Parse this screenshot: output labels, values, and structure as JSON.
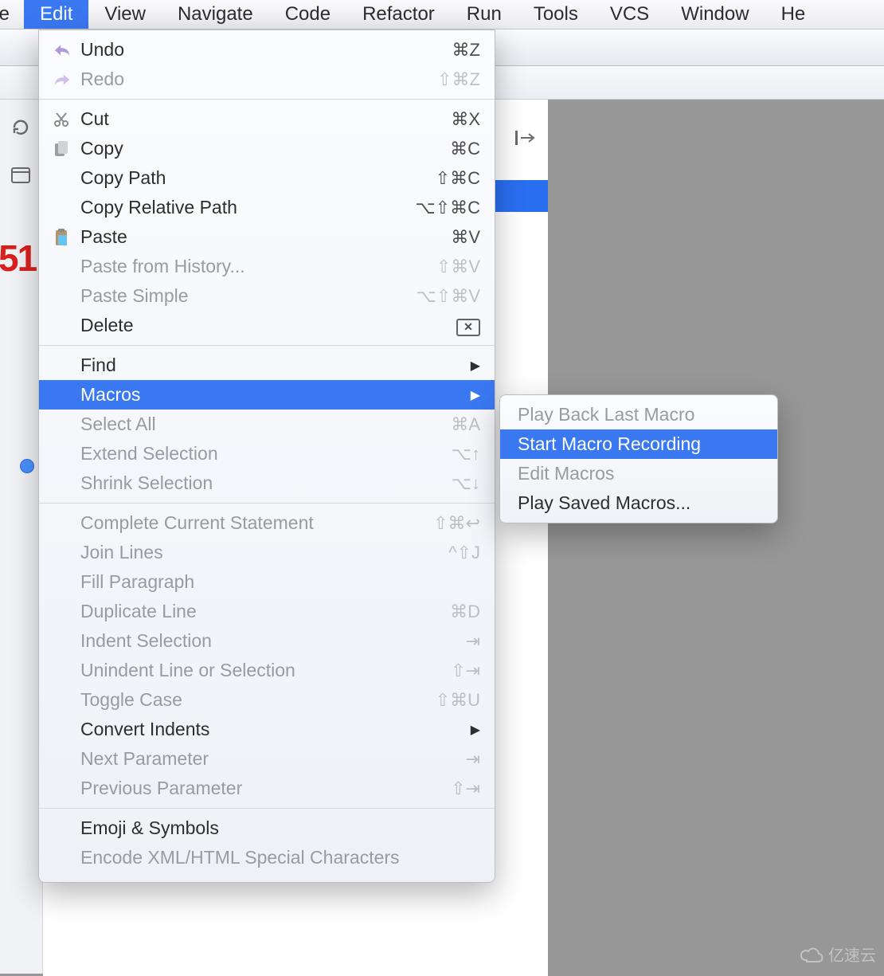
{
  "menubar": {
    "items": [
      {
        "label": "ile"
      },
      {
        "label": "Edit",
        "active": true
      },
      {
        "label": "View"
      },
      {
        "label": "Navigate"
      },
      {
        "label": "Code"
      },
      {
        "label": "Refactor"
      },
      {
        "label": "Run"
      },
      {
        "label": "Tools"
      },
      {
        "label": "VCS"
      },
      {
        "label": "Window"
      },
      {
        "label": "He"
      }
    ]
  },
  "dropdown": {
    "groups": [
      [
        {
          "icon": "undo-icon",
          "label": "Undo",
          "shortcut": "⌘Z",
          "disabled": false
        },
        {
          "icon": "redo-icon",
          "label": "Redo",
          "shortcut": "⇧⌘Z",
          "disabled": true
        }
      ],
      [
        {
          "icon": "cut-icon",
          "label": "Cut",
          "shortcut": "⌘X",
          "disabled": false
        },
        {
          "icon": "copy-icon",
          "label": "Copy",
          "shortcut": "⌘C",
          "disabled": false
        },
        {
          "icon": "",
          "label": "Copy Path",
          "shortcut": "⇧⌘C",
          "disabled": false
        },
        {
          "icon": "",
          "label": "Copy Relative Path",
          "shortcut": "⌥⇧⌘C",
          "disabled": false
        },
        {
          "icon": "paste-icon",
          "label": "Paste",
          "shortcut": "⌘V",
          "disabled": false
        },
        {
          "icon": "",
          "label": "Paste from History...",
          "shortcut": "⇧⌘V",
          "disabled": true
        },
        {
          "icon": "",
          "label": "Paste Simple",
          "shortcut": "⌥⇧⌘V",
          "disabled": true
        },
        {
          "icon": "delete-icon",
          "label": "Delete",
          "shortcut": "",
          "disabled": false,
          "trailing_icon": "delete-box-icon"
        }
      ],
      [
        {
          "icon": "",
          "label": "Find",
          "submenu": true,
          "disabled": false
        },
        {
          "icon": "",
          "label": "Macros",
          "submenu": true,
          "disabled": false,
          "highlight": true
        },
        {
          "icon": "",
          "label": "Select All",
          "shortcut": "⌘A",
          "disabled": true
        },
        {
          "icon": "",
          "label": "Extend Selection",
          "shortcut": "⌥↑",
          "disabled": true
        },
        {
          "icon": "",
          "label": "Shrink Selection",
          "shortcut": "⌥↓",
          "disabled": true
        }
      ],
      [
        {
          "icon": "",
          "label": "Complete Current Statement",
          "shortcut": "⇧⌘↩",
          "disabled": true
        },
        {
          "icon": "",
          "label": "Join Lines",
          "shortcut": "^⇧J",
          "disabled": true
        },
        {
          "icon": "",
          "label": "Fill Paragraph",
          "shortcut": "",
          "disabled": true
        },
        {
          "icon": "",
          "label": "Duplicate Line",
          "shortcut": "⌘D",
          "disabled": true
        },
        {
          "icon": "",
          "label": "Indent Selection",
          "shortcut": "⇥",
          "disabled": true
        },
        {
          "icon": "",
          "label": "Unindent Line or Selection",
          "shortcut": "⇧⇥",
          "disabled": true
        },
        {
          "icon": "",
          "label": "Toggle Case",
          "shortcut": "⇧⌘U",
          "disabled": true
        },
        {
          "icon": "",
          "label": "Convert Indents",
          "submenu": true,
          "disabled": false
        },
        {
          "icon": "",
          "label": "Next Parameter",
          "shortcut": "⇥",
          "disabled": true
        },
        {
          "icon": "",
          "label": "Previous Parameter",
          "shortcut": "⇧⇥",
          "disabled": true
        }
      ],
      [
        {
          "icon": "",
          "label": "Emoji & Symbols",
          "shortcut": "",
          "disabled": false
        },
        {
          "icon": "",
          "label": "Encode XML/HTML Special Characters",
          "shortcut": "",
          "disabled": true
        }
      ]
    ]
  },
  "submenu": {
    "items": [
      {
        "label": "Play Back Last Macro",
        "disabled": true
      },
      {
        "label": "Start Macro Recording",
        "highlight": true
      },
      {
        "label": "Edit Macros",
        "disabled": true
      },
      {
        "label": "Play Saved Macros...",
        "disabled": false
      }
    ]
  },
  "left_gutter": {
    "red_text": "51"
  },
  "watermark": {
    "text": "亿速云"
  }
}
